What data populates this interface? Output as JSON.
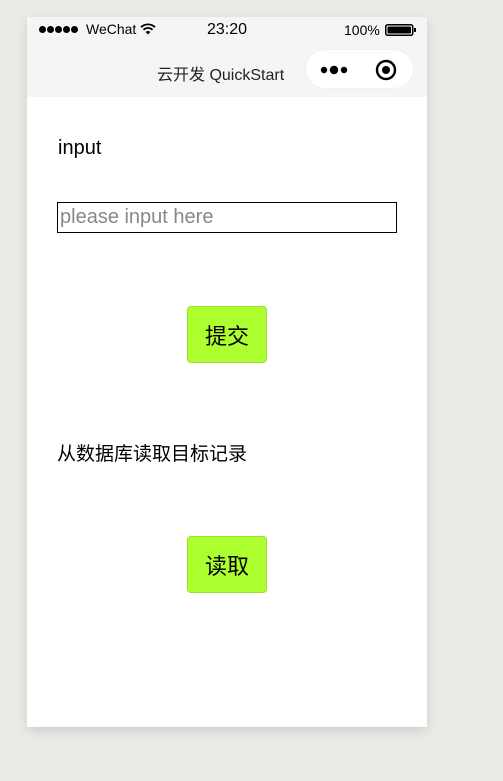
{
  "status_bar": {
    "carrier": "WeChat",
    "time": "23:20",
    "battery_percent": "100%",
    "icons": [
      "signal-dots-icon",
      "wifi-icon",
      "battery-icon"
    ]
  },
  "nav_bar": {
    "title": "云开发 QuickStart",
    "icons": [
      "more-icon",
      "target-icon"
    ]
  },
  "form": {
    "input_label": "input",
    "input_value": "",
    "input_placeholder": "please input here",
    "submit_label": "提交"
  },
  "read_section": {
    "label": "从数据库读取目标记录",
    "read_label": "读取"
  },
  "colors": {
    "page_background": "#ebeae6",
    "bar_background": "#f5f5f5",
    "button_background": "#adff2f"
  }
}
